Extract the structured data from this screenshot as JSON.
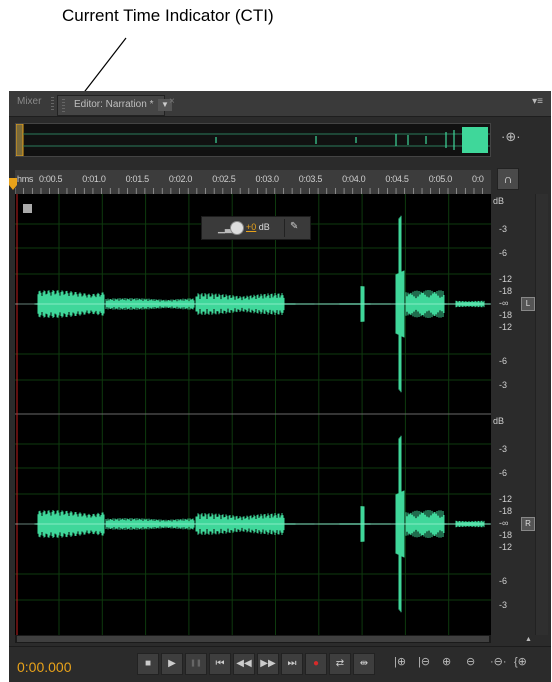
{
  "callout": {
    "text": "Current Time Indicator (CTI)"
  },
  "tabs": {
    "mixer": "Mixer",
    "editor": "Editor: Narration *",
    "dropdown": "▼",
    "close": "×",
    "panel_menu": "▾≡"
  },
  "timeline": {
    "ticks": [
      "hms",
      "0:00.5",
      "0:01.0",
      "0:01.5",
      "0:02.0",
      "0:02.5",
      "0:03.0",
      "0:03.5",
      "0:04.0",
      "0:04.5",
      "0:05.0",
      "0:0"
    ]
  },
  "hud": {
    "value": "+0",
    "unit": "dB"
  },
  "channels": {
    "left": {
      "label": "L",
      "db_unit": "dB",
      "db_ticks": [
        "-3",
        "-6",
        "-12",
        "-18",
        "-∞",
        "-18",
        "-12",
        "-6",
        "-3"
      ]
    },
    "right": {
      "label": "R",
      "db_unit": "dB",
      "db_ticks": [
        "-3",
        "-6",
        "-12",
        "-18",
        "-∞",
        "-18",
        "-12",
        "-6",
        "-3"
      ]
    }
  },
  "transport": {
    "time": "0:00.000",
    "buttons": [
      {
        "name": "stop-button",
        "glyph": "■"
      },
      {
        "name": "play-button",
        "glyph": "▶"
      },
      {
        "name": "pause-button",
        "glyph": "❚❚"
      },
      {
        "name": "go-to-start-button",
        "glyph": "⏮"
      },
      {
        "name": "rewind-button",
        "glyph": "◀◀"
      },
      {
        "name": "fast-forward-button",
        "glyph": "▶▶"
      },
      {
        "name": "go-to-end-button",
        "glyph": "⏭"
      },
      {
        "name": "record-button",
        "glyph": "●"
      },
      {
        "name": "loop-button",
        "glyph": "⇄"
      },
      {
        "name": "skip-selection-button",
        "glyph": "⇹"
      }
    ],
    "zoom_buttons": [
      {
        "name": "zoom-in-amplitude-icon",
        "glyph": "|⊕"
      },
      {
        "name": "zoom-out-amplitude-icon",
        "glyph": "|⊖"
      },
      {
        "name": "zoom-in-time-icon",
        "glyph": "⊕"
      },
      {
        "name": "zoom-out-time-icon",
        "glyph": "⊖"
      },
      {
        "name": "zoom-out-full-icon",
        "glyph": "·⊖·"
      },
      {
        "name": "zoom-in-selection-icon",
        "glyph": "{⊕"
      }
    ]
  },
  "colors": {
    "waveform": "#3fd79a",
    "cti": "#e8a21a",
    "record": "#d62a2a"
  }
}
